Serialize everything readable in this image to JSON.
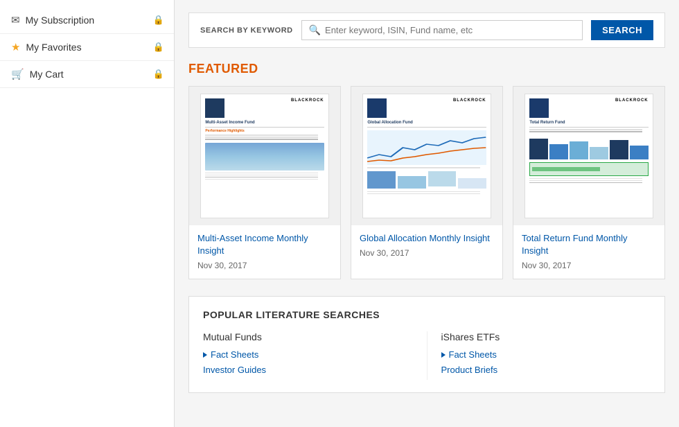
{
  "sidebar": {
    "items": [
      {
        "id": "subscription",
        "label": "My Subscription",
        "icon": "✉",
        "locked": true
      },
      {
        "id": "favorites",
        "label": "My Favorites",
        "icon": "★",
        "locked": true
      },
      {
        "id": "cart",
        "label": "My Cart",
        "icon": "🛒",
        "locked": true
      }
    ]
  },
  "search": {
    "label": "SEARCH BY KEYWORD",
    "placeholder": "Enter keyword, ISIN, Fund name, etc",
    "button": "SEARCH"
  },
  "featured": {
    "title": "FEATURED",
    "cards": [
      {
        "title": "Multi-Asset Income Monthly Insight",
        "date": "Nov 30, 2017",
        "brand": "BLACKROCK",
        "doc_title": "Multi-Asset Income Fund"
      },
      {
        "title": "Global Allocation Monthly Insight",
        "date": "Nov 30, 2017",
        "brand": "BLACKROCK",
        "doc_title": "Global Allocation Fund"
      },
      {
        "title": "Total Return Fund Monthly Insight",
        "date": "Nov 30, 2017",
        "brand": "BLACKROCK",
        "doc_title": "Total Return Fund"
      }
    ]
  },
  "popular": {
    "title": "POPULAR LITERATURE SEARCHES",
    "columns": [
      {
        "title": "Mutual Funds",
        "links": [
          {
            "label": "Fact Sheets",
            "arrow": true
          },
          {
            "label": "Investor Guides",
            "arrow": false
          }
        ]
      },
      {
        "title": "iShares ETFs",
        "links": [
          {
            "label": "Fact Sheets",
            "arrow": true
          },
          {
            "label": "Product Briefs",
            "arrow": false
          }
        ]
      }
    ]
  }
}
